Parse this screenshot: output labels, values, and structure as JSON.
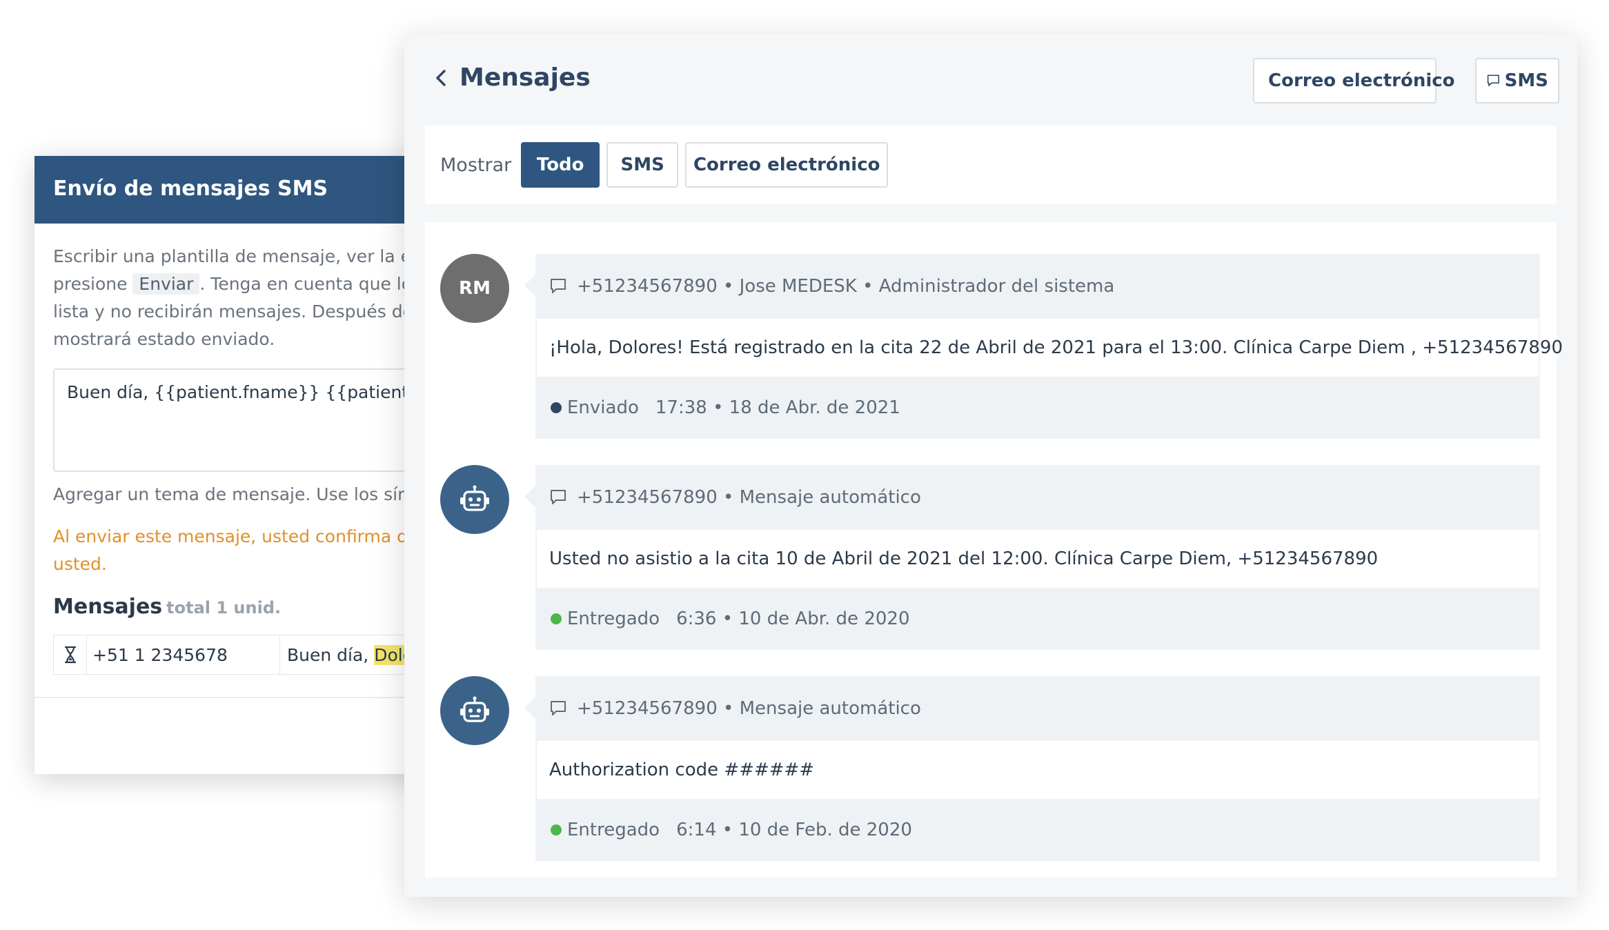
{
  "sms_panel": {
    "title": "Envío de mensajes SMS",
    "desc_line1": "Escribir una plantilla de mensaje, ver la ex",
    "desc_line2_a": "presione ",
    "desc_line2_key": "Enviar",
    "desc_line2_b": ". Tenga en cuenta que los",
    "desc_line3": "lista y no recibirán mensajes. Después de",
    "desc_line4": "mostrará estado enviado.",
    "template_value": "Buen día, {{patient.fname}} {{patient.lna",
    "topic_hint": "Agregar un tema de mensaje. Use los sím",
    "warning_line1": "Al enviar este mensaje, usted confirma qu",
    "warning_line2": "usted.",
    "messages_heading": "Mensajes",
    "messages_count": "total 1 unid.",
    "row": {
      "phone": "+51 1 2345678",
      "text_a": "Buen día, ",
      "text_highlight": "Dolc"
    }
  },
  "messages_panel": {
    "title": "Mensajes",
    "btn_email": "Correo electrónico",
    "btn_sms": "SMS",
    "filter": {
      "label": "Mostrar",
      "tabs": [
        "Todo",
        "SMS",
        "Correo electrónico"
      ],
      "active": "Todo"
    },
    "threads": [
      {
        "avatar": "RM",
        "header": "+51234567890 • Jose MEDESK • Administrador del sistema",
        "body": "¡Hola, Dolores! Está registrado en la cita 22 de Abril de 2021 para el 13:00. Clínica Carpe Diem , +51234567890",
        "status": "Enviado",
        "status_color": "#2e4663",
        "time": "17:38 • 18 de Abr. de 2021"
      },
      {
        "avatar": "",
        "header": "+51234567890 • Mensaje automático",
        "body": "Usted no asistio a la cita 10 de Abril de 2021 del 12:00. Clínica Carpe Diem, +51234567890",
        "status": "Entregado",
        "status_color": "#4cb648",
        "time": "6:36 • 10 de Abr. de 2020"
      },
      {
        "avatar": "",
        "header": "+51234567890 • Mensaje automático",
        "body": "Authorization code ######",
        "status": "Entregado",
        "status_color": "#4cb648",
        "time": "6:14 • 10 de Feb. de 2020"
      }
    ]
  },
  "icons": {
    "back": "chevron-left-icon",
    "email": "envelope-icon",
    "sms": "speech-bubble-icon",
    "robot": "robot-icon",
    "hourglass": "hourglass-icon"
  },
  "colors": {
    "primary": "#2e5680",
    "text_dark": "#2e4663",
    "warning": "#e0902c",
    "delivered": "#4cb648",
    "highlight": "#f5e36c"
  }
}
